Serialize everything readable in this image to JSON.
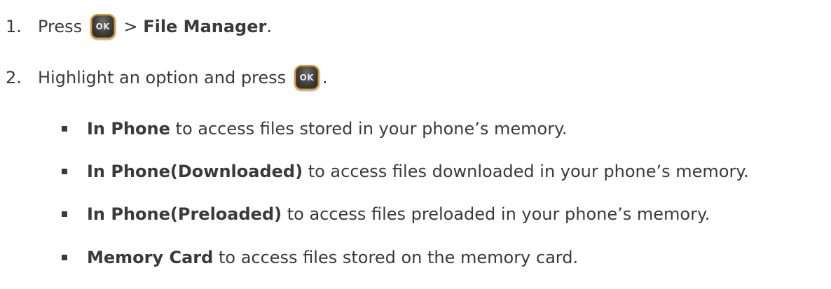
{
  "steps": [
    {
      "number": "1.",
      "prefix": "Press",
      "key_label": "OK",
      "separator": ">",
      "target": "File Manager",
      "suffix": "."
    },
    {
      "number": "2.",
      "prefix": "Highlight an option and press",
      "key_label": "OK",
      "suffix": "."
    }
  ],
  "options": [
    {
      "name": "In Phone",
      "description": "to access files stored in your phone’s memory."
    },
    {
      "name": "In Phone(Downloaded)",
      "description": "to access files downloaded in your phone’s memory."
    },
    {
      "name": "In Phone(Preloaded)",
      "description": "to access files preloaded in your phone’s memory."
    },
    {
      "name": "Memory Card",
      "description": "to access files stored on the memory card."
    }
  ],
  "colors": {
    "text": "#3a3a3a",
    "key_border": "#d6a23a",
    "key_face": "#3d3d3d"
  },
  "icons": {
    "ok_key": "ok-key-icon",
    "bullet": "square-bullet-icon"
  }
}
